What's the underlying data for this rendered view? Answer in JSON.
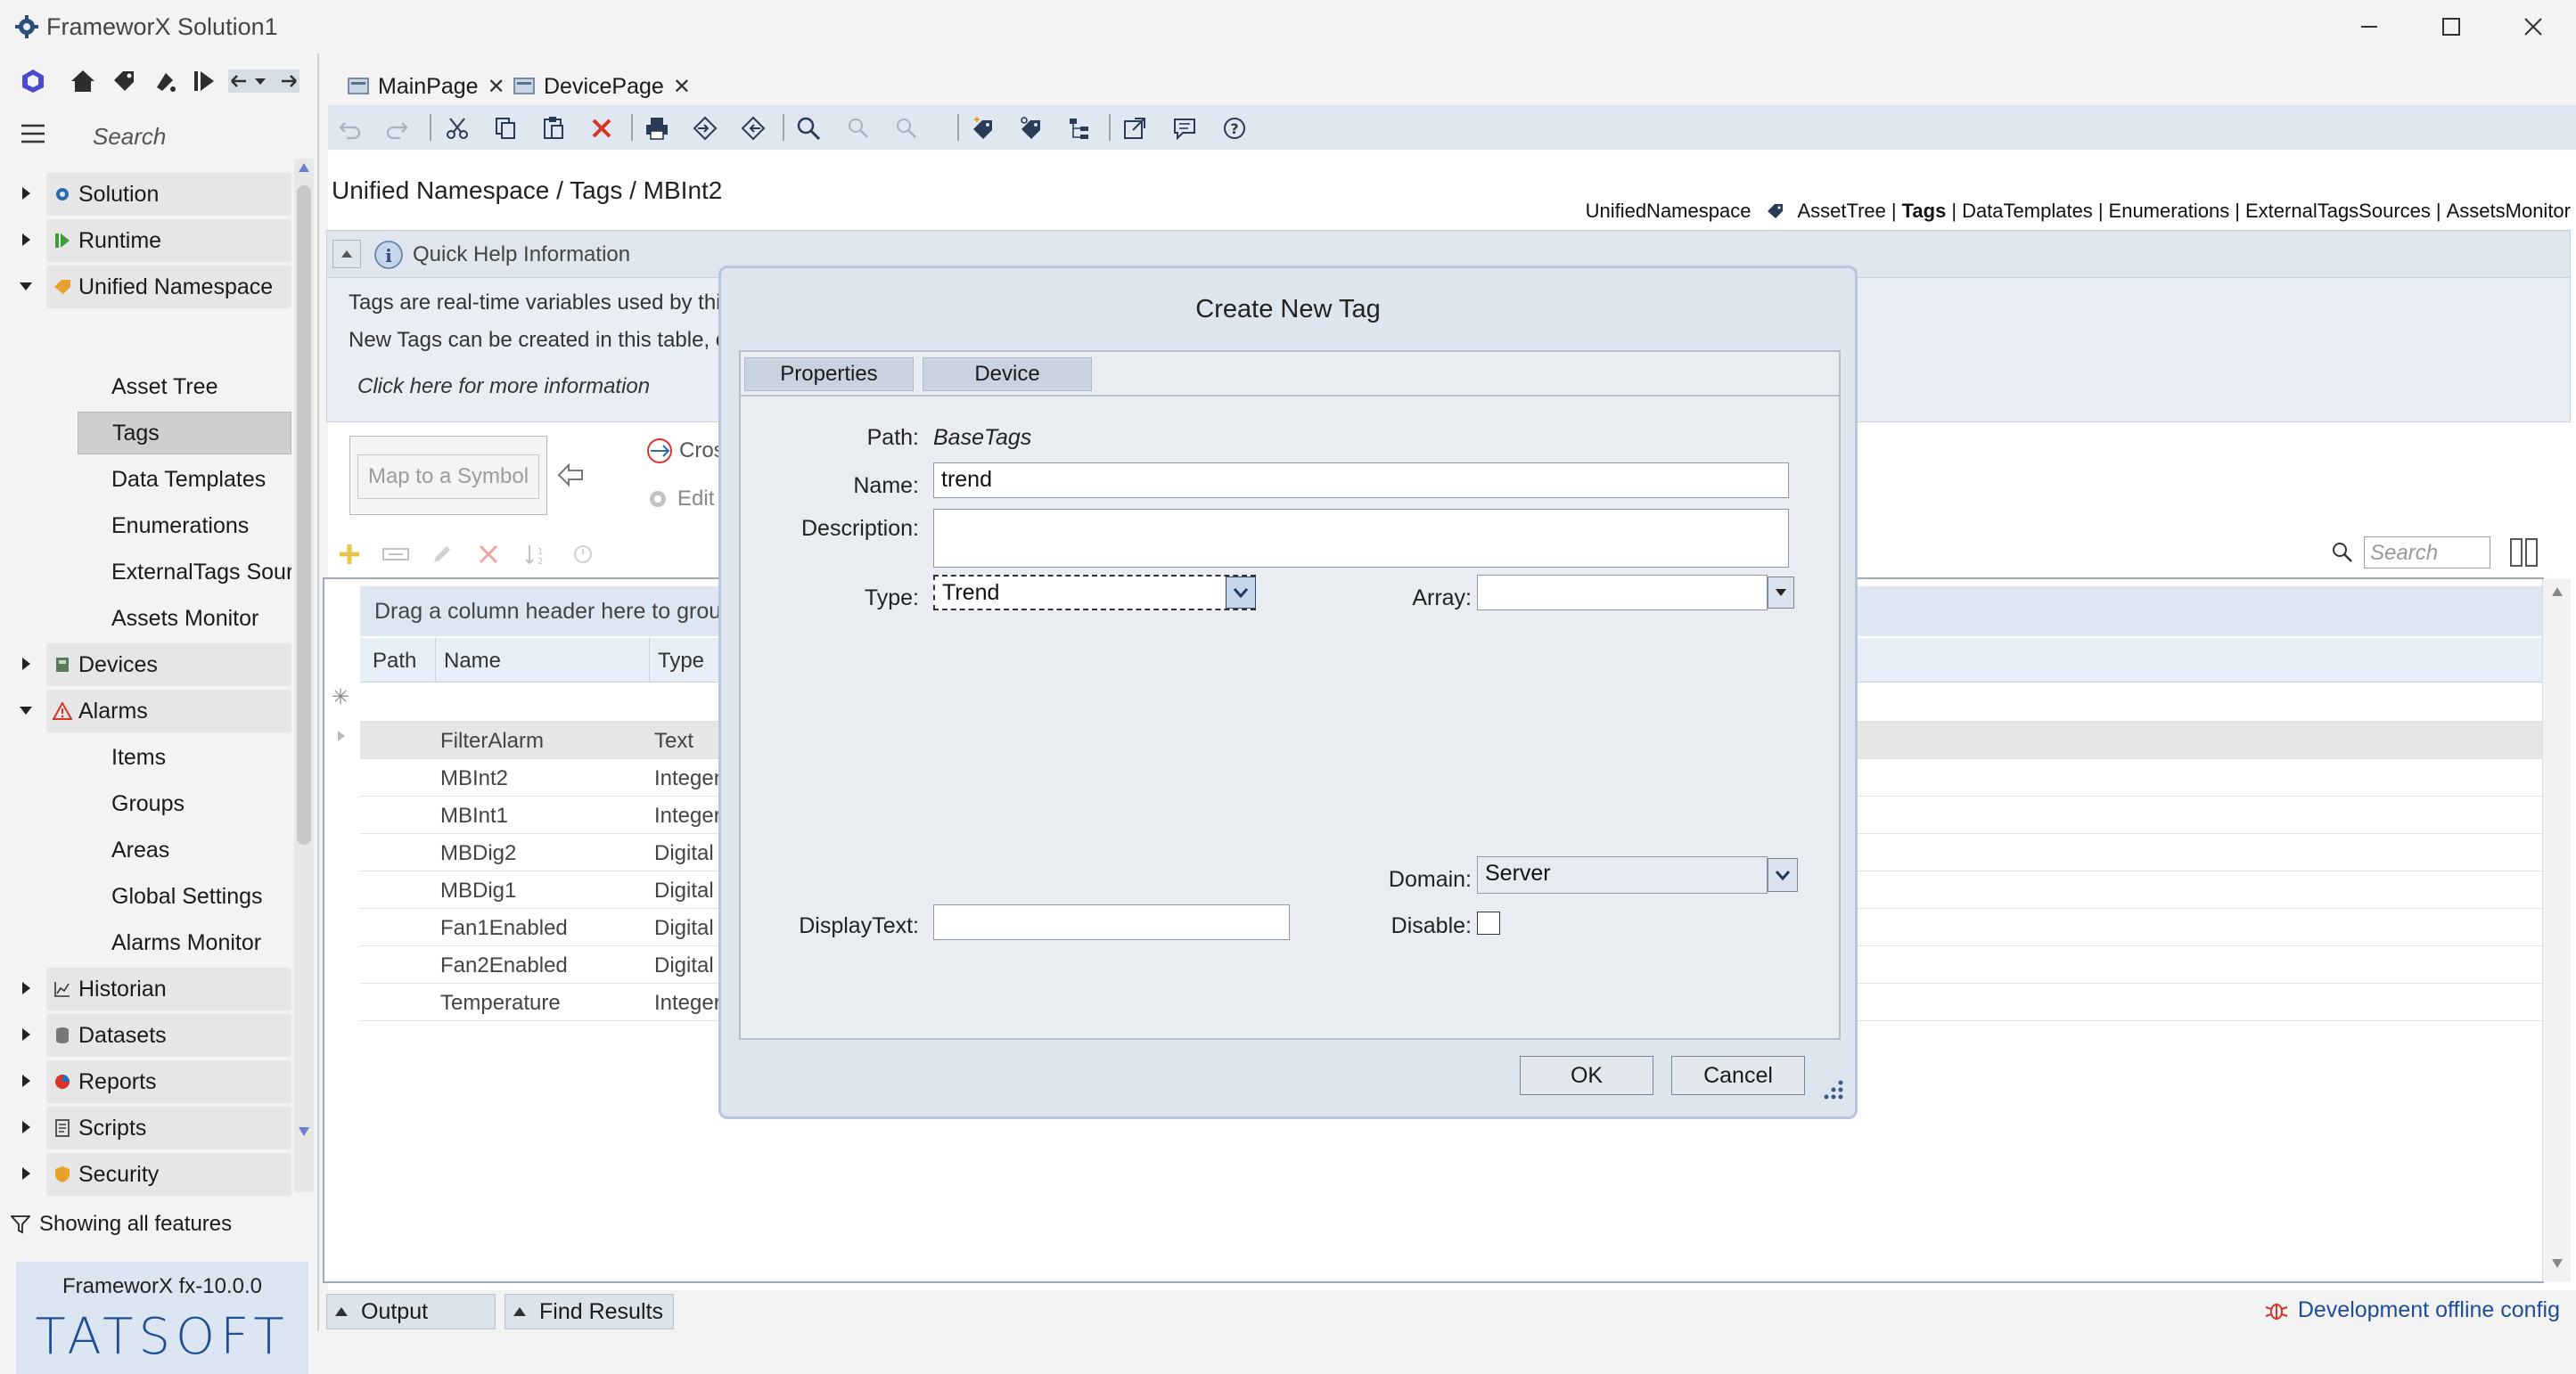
{
  "window": {
    "title": "FrameworX Solution1"
  },
  "sidebar": {
    "search_placeholder": "Search",
    "items": [
      {
        "label": "Solution",
        "icon": "gear-icon"
      },
      {
        "label": "Runtime",
        "icon": "runtime-icon"
      },
      {
        "label": "Unified Namespace",
        "icon": "tag-icon"
      },
      {
        "label": "Asset Tree"
      },
      {
        "label": "Tags"
      },
      {
        "label": "Data Templates"
      },
      {
        "label": "Enumerations"
      },
      {
        "label": "ExternalTags Sources"
      },
      {
        "label": "Assets Monitor"
      },
      {
        "label": "Devices",
        "icon": "device-icon"
      },
      {
        "label": "Alarms",
        "icon": "warning-icon"
      },
      {
        "label": "Items"
      },
      {
        "label": "Groups"
      },
      {
        "label": "Areas"
      },
      {
        "label": "Global Settings"
      },
      {
        "label": "Alarms Monitor"
      },
      {
        "label": "Historian",
        "icon": "chart-icon"
      },
      {
        "label": "Datasets",
        "icon": "database-icon"
      },
      {
        "label": "Reports",
        "icon": "pie-icon"
      },
      {
        "label": "Scripts",
        "icon": "script-icon"
      },
      {
        "label": "Security",
        "icon": "shield-icon"
      }
    ],
    "filter_text": "Showing all features",
    "version": "FrameworX fx-10.0.0",
    "brand": "TATSOFT"
  },
  "tabs": [
    {
      "label": "MainPage"
    },
    {
      "label": "DevicePage"
    }
  ],
  "page": {
    "breadcrumb": "Unified Namespace / Tags / MBInt2",
    "nav": {
      "root": "UnifiedNamespace",
      "links": [
        "AssetTree",
        "Tags",
        "DataTemplates",
        "Enumerations",
        "ExternalTagsSources",
        "AssetsMonitor"
      ],
      "active": "Tags",
      "separator": "|"
    },
    "quick_help": {
      "title": "Quick Help Information",
      "line1": "Tags are  real-time variables used by thi",
      "line2": "New Tags can be created in this table, c",
      "link": "Click here for more information"
    },
    "map_button": "Map to a Symbol",
    "cross_label": "Cros",
    "edit_label": "Edit",
    "grid_search_placeholder": "Search",
    "grid": {
      "group_hint": "Drag a column header here to group",
      "columns": [
        "Path",
        "Name",
        "Type"
      ],
      "rows": [
        {
          "name": "FilterAlarm",
          "type": "Text"
        },
        {
          "name": "MBInt2",
          "type": "Integer"
        },
        {
          "name": "MBInt1",
          "type": "Integer"
        },
        {
          "name": "MBDig2",
          "type": "Digital"
        },
        {
          "name": "MBDig1",
          "type": "Digital"
        },
        {
          "name": "Fan1Enabled",
          "type": "Digital"
        },
        {
          "name": "Fan2Enabled",
          "type": "Digital"
        },
        {
          "name": "Temperature",
          "type": "Integer"
        }
      ]
    }
  },
  "dialog": {
    "title": "Create New Tag",
    "tabs": [
      "Properties",
      "Device"
    ],
    "path_label": "Path:",
    "path_value": "BaseTags",
    "name_label": "Name:",
    "name_value": "trend",
    "description_label": "Description:",
    "description_value": "",
    "type_label": "Type:",
    "type_value": "Trend",
    "array_label": "Array:",
    "array_value": "",
    "domain_label": "Domain:",
    "domain_value": "Server",
    "displaytext_label": "DisplayText:",
    "displaytext_value": "",
    "disable_label": "Disable:",
    "disable_checked": false,
    "ok_label": "OK",
    "cancel_label": "Cancel"
  },
  "bottom": {
    "output_label": "Output",
    "find_label": "Find Results",
    "status": "Development offline config"
  },
  "colors": {
    "accent": "#1f4e96",
    "dialog_bg": "#dde5ef",
    "toolbar_bg": "#dfe7f0",
    "delete_red": "#d9342b"
  }
}
